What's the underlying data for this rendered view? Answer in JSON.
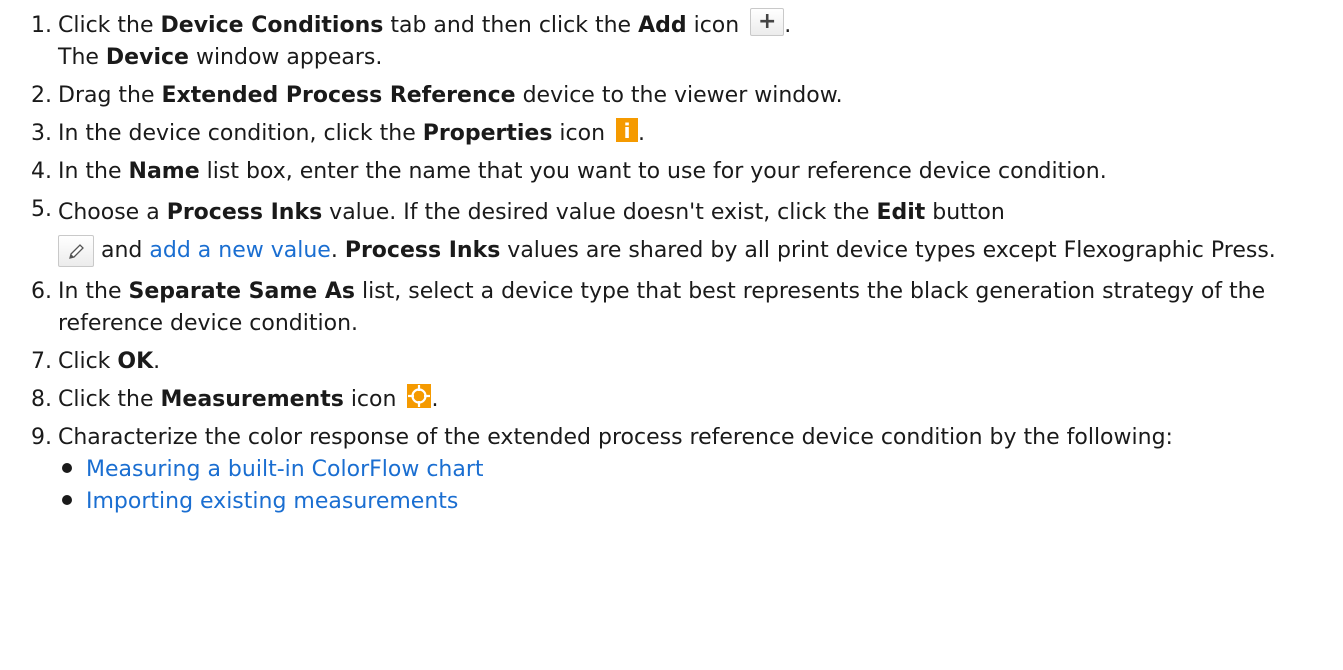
{
  "steps": [
    {
      "num": "1.",
      "t1": "Click the ",
      "b1": "Device Conditions",
      "t2": " tab and then click the ",
      "b2": "Add",
      "t3": " icon ",
      "add_icon": "+",
      "t4": ".",
      "l2a": "The ",
      "l2b": "Device",
      "l2c": " window appears."
    },
    {
      "num": "2.",
      "t1": "Drag the ",
      "b1": "Extended Process Reference",
      "t2": " device to the viewer window."
    },
    {
      "num": "3.",
      "t1": "In the device condition, click the ",
      "b1": "Properties",
      "t2": " icon ",
      "info_icon": "i",
      "t3": "."
    },
    {
      "num": "4.",
      "t1": "In the ",
      "b1": "Name",
      "t2": " list box, enter the name that you want to use for your reference device condition."
    },
    {
      "num": "5.",
      "t1": "Choose a ",
      "b1": "Process Inks",
      "t2": " value. If the desired value doesn't exist, click the ",
      "b2": "Edit",
      "t3": "  button",
      "t4": " and ",
      "link": "add a new value",
      "t5": ". ",
      "b3": "Process Inks",
      "t6": " values are shared by all print device types except Flexographic Press."
    },
    {
      "num": "6.",
      "t1": "In the ",
      "b1": "Separate Same As",
      "t2": " list, select a device type that best represents the black generation strategy of the reference device condition."
    },
    {
      "num": "7.",
      "t1": "Click ",
      "b1": "OK",
      "t2": "."
    },
    {
      "num": "8.",
      "t1": "Click the ",
      "b1": "Measurements",
      "t2": " icon ",
      "t3": "."
    },
    {
      "num": "9.",
      "t1": "Characterize the color response of the extended process reference device condition by the following:",
      "subitems": [
        "Measuring a built-in ColorFlow chart",
        "Importing existing measurements"
      ]
    }
  ],
  "icons": {
    "add": "add-icon",
    "properties": "info-icon",
    "edit": "pencil-icon",
    "measurements": "crosshair-icon"
  },
  "colors": {
    "link": "#1a6ed1",
    "orange": "#f59a00"
  }
}
